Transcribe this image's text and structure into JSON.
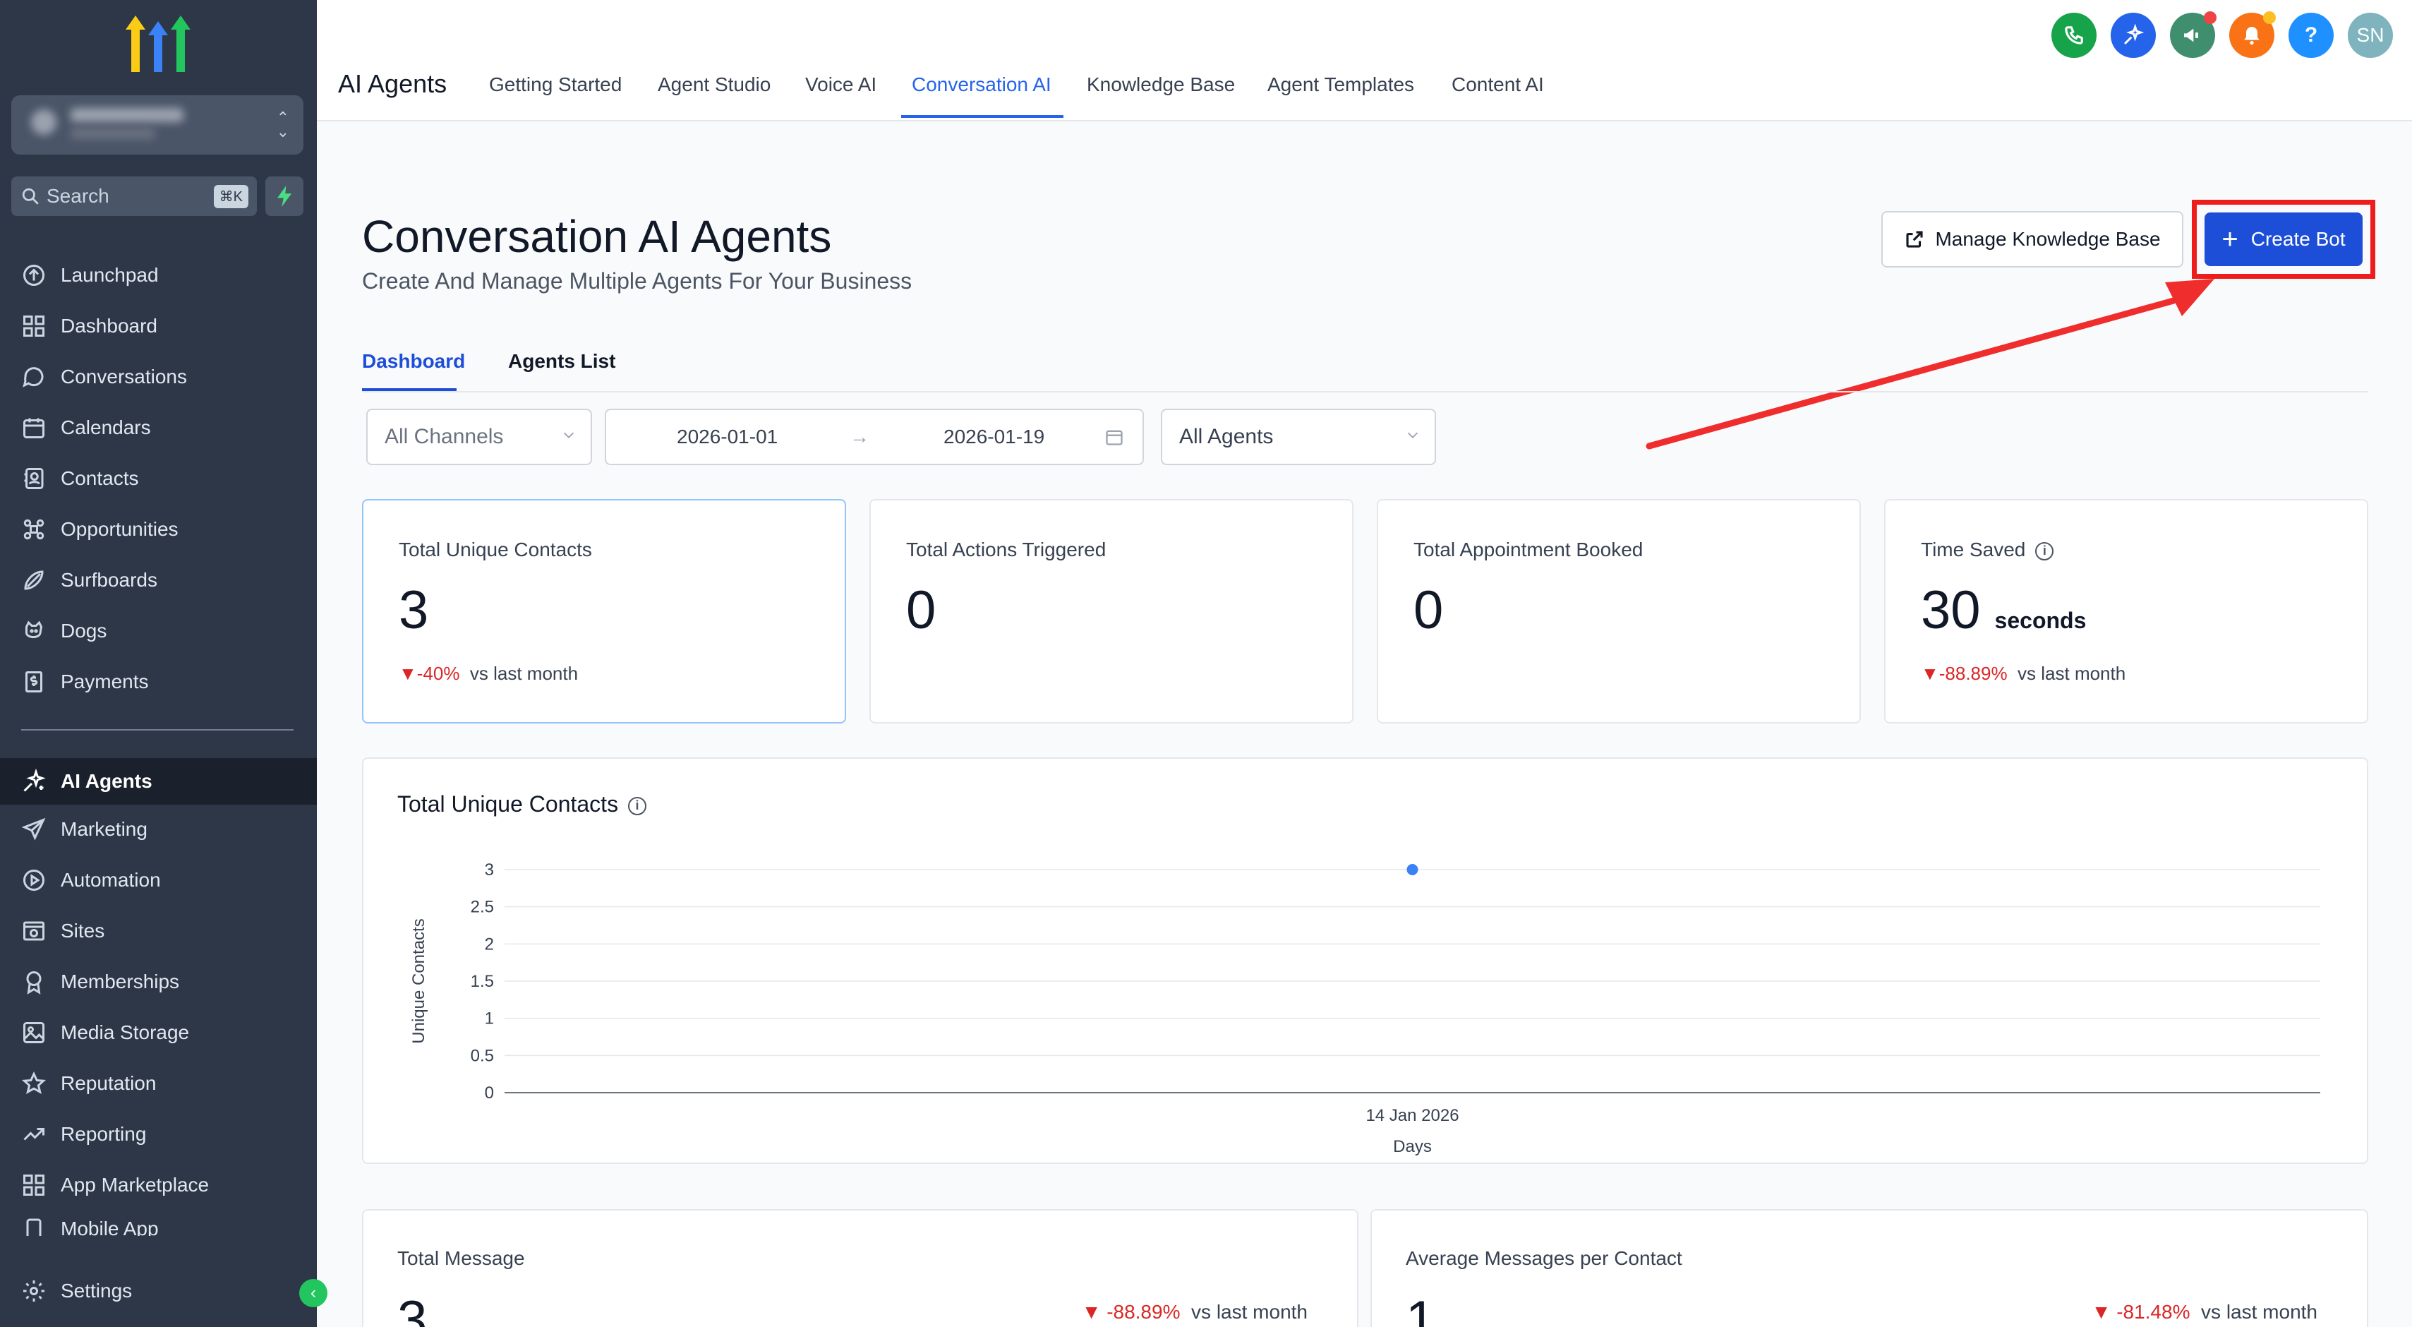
{
  "sidebar": {
    "search_placeholder": "Search",
    "search_shortcut": "⌘K",
    "items": [
      {
        "label": "Launchpad",
        "icon": "launchpad-icon"
      },
      {
        "label": "Dashboard",
        "icon": "dashboard-icon"
      },
      {
        "label": "Conversations",
        "icon": "chat-icon"
      },
      {
        "label": "Calendars",
        "icon": "calendar-icon"
      },
      {
        "label": "Contacts",
        "icon": "contacts-icon"
      },
      {
        "label": "Opportunities",
        "icon": "opportunities-icon"
      },
      {
        "label": "Surfboards",
        "icon": "surfboard-icon"
      },
      {
        "label": "Dogs",
        "icon": "dog-icon"
      },
      {
        "label": "Payments",
        "icon": "payments-icon"
      },
      {
        "label": "AI Agents",
        "icon": "ai-sparkle-icon"
      },
      {
        "label": "Marketing",
        "icon": "send-icon"
      },
      {
        "label": "Automation",
        "icon": "automation-icon"
      },
      {
        "label": "Sites",
        "icon": "sites-icon"
      },
      {
        "label": "Memberships",
        "icon": "award-icon"
      },
      {
        "label": "Media Storage",
        "icon": "image-icon"
      },
      {
        "label": "Reputation",
        "icon": "star-icon"
      },
      {
        "label": "Reporting",
        "icon": "trend-icon"
      },
      {
        "label": "App Marketplace",
        "icon": "grid-icon"
      },
      {
        "label": "Mobile App",
        "icon": "mobile-icon"
      }
    ],
    "settings_label": "Settings"
  },
  "topbar": {
    "brand": "AI Agents",
    "tabs": [
      "Getting Started",
      "Agent Studio",
      "Voice AI",
      "Conversation AI",
      "Knowledge Base",
      "Agent Templates",
      "Content AI"
    ],
    "active_tab": "Conversation AI",
    "help_label": "?",
    "avatar_initials": "SN",
    "colors": {
      "phone": "#16a34a",
      "sparkle": "#2563eb",
      "megaphone": "#3f8f6f",
      "bell": "#f97316",
      "help": "#1e90ff",
      "avatar": "#7fb3bd"
    }
  },
  "header": {
    "title": "Conversation AI Agents",
    "subtitle": "Create And Manage Multiple Agents For Your Business",
    "manage_kb_label": "Manage Knowledge Base",
    "create_bot_label": "Create Bot"
  },
  "subtabs": [
    "Dashboard",
    "Agents List"
  ],
  "filters": {
    "channel": "All Channels",
    "date_start": "2026-01-01",
    "date_end": "2026-01-19",
    "agent": "All Agents"
  },
  "stats": [
    {
      "title": "Total Unique Contacts",
      "value": "3",
      "unit": "",
      "change": "-40%",
      "compare": "vs last month"
    },
    {
      "title": "Total Actions Triggered",
      "value": "0",
      "unit": "",
      "change": "",
      "compare": ""
    },
    {
      "title": "Total Appointment Booked",
      "value": "0",
      "unit": "",
      "change": "",
      "compare": ""
    },
    {
      "title": "Time Saved",
      "value": "30",
      "unit": "seconds",
      "change": "-88.89%",
      "compare": "vs last month"
    }
  ],
  "chart_data": {
    "type": "scatter",
    "title": "Total Unique Contacts",
    "xlabel": "Days",
    "ylabel": "Unique Contacts",
    "ylim": [
      0,
      3
    ],
    "yticks": [
      "0",
      "0.5",
      "1",
      "1.5",
      "2",
      "2.5",
      "3"
    ],
    "x": [
      "14 Jan 2026"
    ],
    "values": [
      3
    ],
    "series_color": "#3b82f6"
  },
  "bottom": [
    {
      "title": "Total Message",
      "value": "3",
      "change": "-88.89%",
      "compare": "vs last month"
    },
    {
      "title": "Average Messages per Contact",
      "value": "1",
      "change": "-81.48%",
      "compare": "vs last month"
    }
  ]
}
